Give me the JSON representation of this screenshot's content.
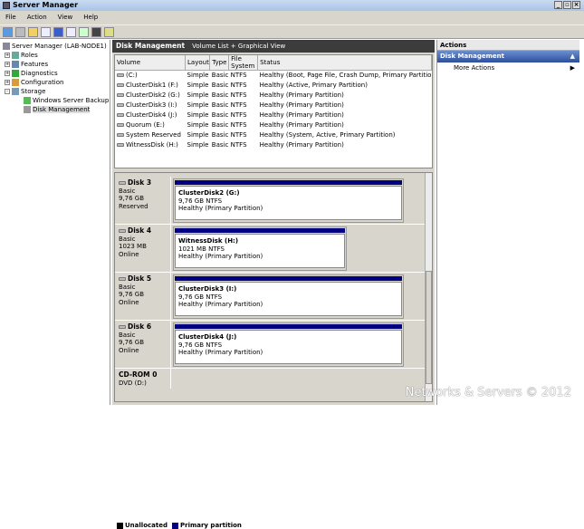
{
  "window": {
    "title": "Server Manager"
  },
  "menu": [
    "File",
    "Action",
    "View",
    "Help"
  ],
  "tree": [
    {
      "label": "Server Manager (LAB-NODE1)",
      "level": 0,
      "exp": ""
    },
    {
      "label": "Roles",
      "level": 1,
      "exp": "+"
    },
    {
      "label": "Features",
      "level": 1,
      "exp": "+"
    },
    {
      "label": "Diagnostics",
      "level": 1,
      "exp": "+"
    },
    {
      "label": "Configuration",
      "level": 1,
      "exp": "+"
    },
    {
      "label": "Storage",
      "level": 1,
      "exp": "-"
    },
    {
      "label": "Windows Server Backup",
      "level": 2,
      "exp": ""
    },
    {
      "label": "Disk Management",
      "level": 2,
      "exp": "",
      "selected": true
    }
  ],
  "center": {
    "title": "Disk Management",
    "subtitle": "Volume List + Graphical View"
  },
  "columns": [
    "Volume",
    "Layout",
    "Type",
    "File System",
    "Status"
  ],
  "volumes": [
    [
      "(C:)",
      "Simple",
      "Basic",
      "NTFS",
      "Healthy (Boot, Page File, Crash Dump, Primary Partitio"
    ],
    [
      "ClusterDisk1 (F:)",
      "Simple",
      "Basic",
      "NTFS",
      "Healthy (Active, Primary Partition)"
    ],
    [
      "ClusterDisk2 (G:)",
      "Simple",
      "Basic",
      "NTFS",
      "Healthy (Primary Partition)"
    ],
    [
      "ClusterDisk3 (I:)",
      "Simple",
      "Basic",
      "NTFS",
      "Healthy (Primary Partition)"
    ],
    [
      "ClusterDisk4 (J:)",
      "Simple",
      "Basic",
      "NTFS",
      "Healthy (Primary Partition)"
    ],
    [
      "Quorum (E:)",
      "Simple",
      "Basic",
      "NTFS",
      "Healthy (Primary Partition)"
    ],
    [
      "System Reserved",
      "Simple",
      "Basic",
      "NTFS",
      "Healthy (System, Active, Primary Partition)"
    ],
    [
      "WitnessDisk (H:)",
      "Simple",
      "Basic",
      "NTFS",
      "Healthy (Primary Partition)"
    ]
  ],
  "disks": [
    {
      "name": "Disk 3",
      "type": "Basic",
      "size": "9,76 GB",
      "state": "Reserved",
      "part": {
        "name": "ClusterDisk2  (G:)",
        "size": "9,76 GB NTFS",
        "status": "Healthy (Primary Partition)"
      }
    },
    {
      "name": "Disk 4",
      "type": "Basic",
      "size": "1023 MB",
      "state": "Online",
      "part": {
        "name": "WitnessDisk  (H:)",
        "size": "1021 MB NTFS",
        "status": "Healthy (Primary Partition)"
      }
    },
    {
      "name": "Disk 5",
      "type": "Basic",
      "size": "9,76 GB",
      "state": "Online",
      "part": {
        "name": "ClusterDisk3  (I:)",
        "size": "9,76 GB NTFS",
        "status": "Healthy (Primary Partition)"
      }
    },
    {
      "name": "Disk 6",
      "type": "Basic",
      "size": "9,76 GB",
      "state": "Online",
      "part": {
        "name": "ClusterDisk4  (J:)",
        "size": "9,76 GB NTFS",
        "status": "Healthy (Primary Partition)"
      }
    }
  ],
  "cdrom": {
    "name": "CD-ROM 0",
    "sub": "DVD (D:)"
  },
  "legend": [
    {
      "label": "Unallocated",
      "color": "#000000"
    },
    {
      "label": "Primary partition",
      "color": "#000080"
    }
  ],
  "actions": {
    "title": "Actions",
    "section": "Disk Management",
    "items": [
      "More Actions"
    ]
  },
  "watermark": "Networks & Servers © 2012"
}
